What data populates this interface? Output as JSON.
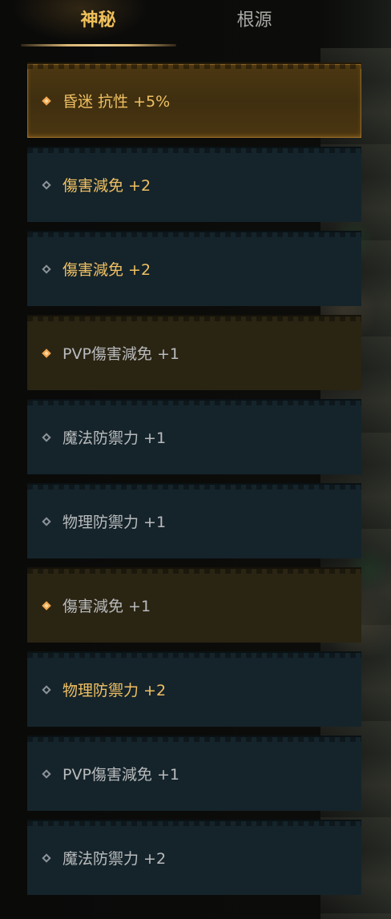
{
  "tabs": [
    {
      "label": "神秘",
      "active": true
    },
    {
      "label": "根源",
      "active": false
    }
  ],
  "colors": {
    "active_tab": "#f0c15a",
    "inactive_tab": "#a9a9a5",
    "highlight_text": "#f0c062",
    "normal_text": "#b9bbbd",
    "row_teal": "#15242b",
    "row_gold": "#2a2413",
    "diamond_gold": "#f2a34b",
    "diamond_grey": "#8d949a"
  },
  "stats": [
    {
      "text": "昏迷 抗性 +5%",
      "style": "selected",
      "highlight": true,
      "icon": "diamond-icon"
    },
    {
      "text": "傷害減免 +2",
      "style": "teal",
      "highlight": true,
      "icon": "diamond-outline-icon"
    },
    {
      "text": "傷害減免 +2",
      "style": "teal",
      "highlight": true,
      "icon": "diamond-outline-icon"
    },
    {
      "text": "PVP傷害減免 +1",
      "style": "gold",
      "highlight": false,
      "icon": "diamond-icon"
    },
    {
      "text": "魔法防禦力 +1",
      "style": "teal",
      "highlight": false,
      "icon": "diamond-outline-icon"
    },
    {
      "text": "物理防禦力 +1",
      "style": "teal",
      "highlight": false,
      "icon": "diamond-outline-icon"
    },
    {
      "text": "傷害減免 +1",
      "style": "gold",
      "highlight": false,
      "icon": "diamond-icon"
    },
    {
      "text": "物理防禦力 +2",
      "style": "teal",
      "highlight": true,
      "icon": "diamond-outline-icon"
    },
    {
      "text": "PVP傷害減免 +1",
      "style": "teal",
      "highlight": false,
      "icon": "diamond-outline-icon"
    },
    {
      "text": "魔法防禦力 +2",
      "style": "teal",
      "highlight": false,
      "icon": "diamond-outline-icon"
    }
  ]
}
